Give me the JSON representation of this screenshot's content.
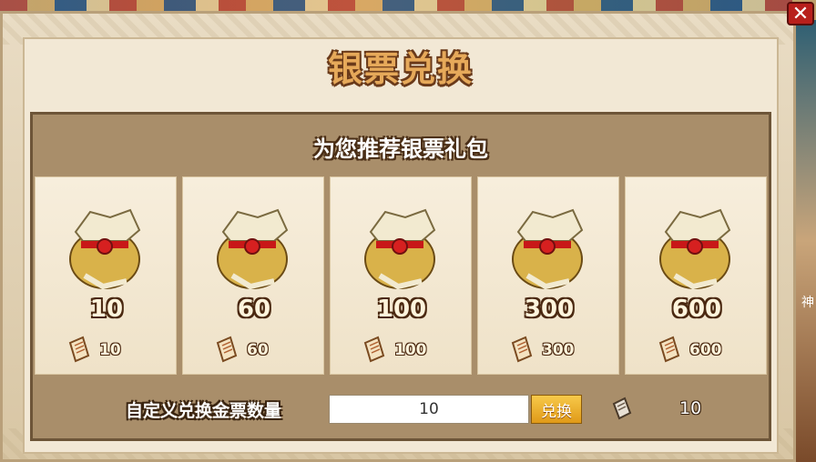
{
  "dialog": {
    "title": "银票兑换",
    "subtitle": "为您推荐银票礼包",
    "close_label": "✕"
  },
  "packages": [
    {
      "amount": "10",
      "cost": "10"
    },
    {
      "amount": "60",
      "cost": "60"
    },
    {
      "amount": "100",
      "cost": "100"
    },
    {
      "amount": "300",
      "cost": "300"
    },
    {
      "amount": "600",
      "cost": "600"
    }
  ],
  "custom": {
    "label": "自定义兑换金票数量",
    "input_value": "10",
    "button_label": "兑换",
    "total_cost": "10"
  },
  "background": {
    "edge_text": "神"
  },
  "colors": {
    "title": "#e6a95a",
    "panel": "#a98e6a",
    "button": "#f0b030"
  }
}
